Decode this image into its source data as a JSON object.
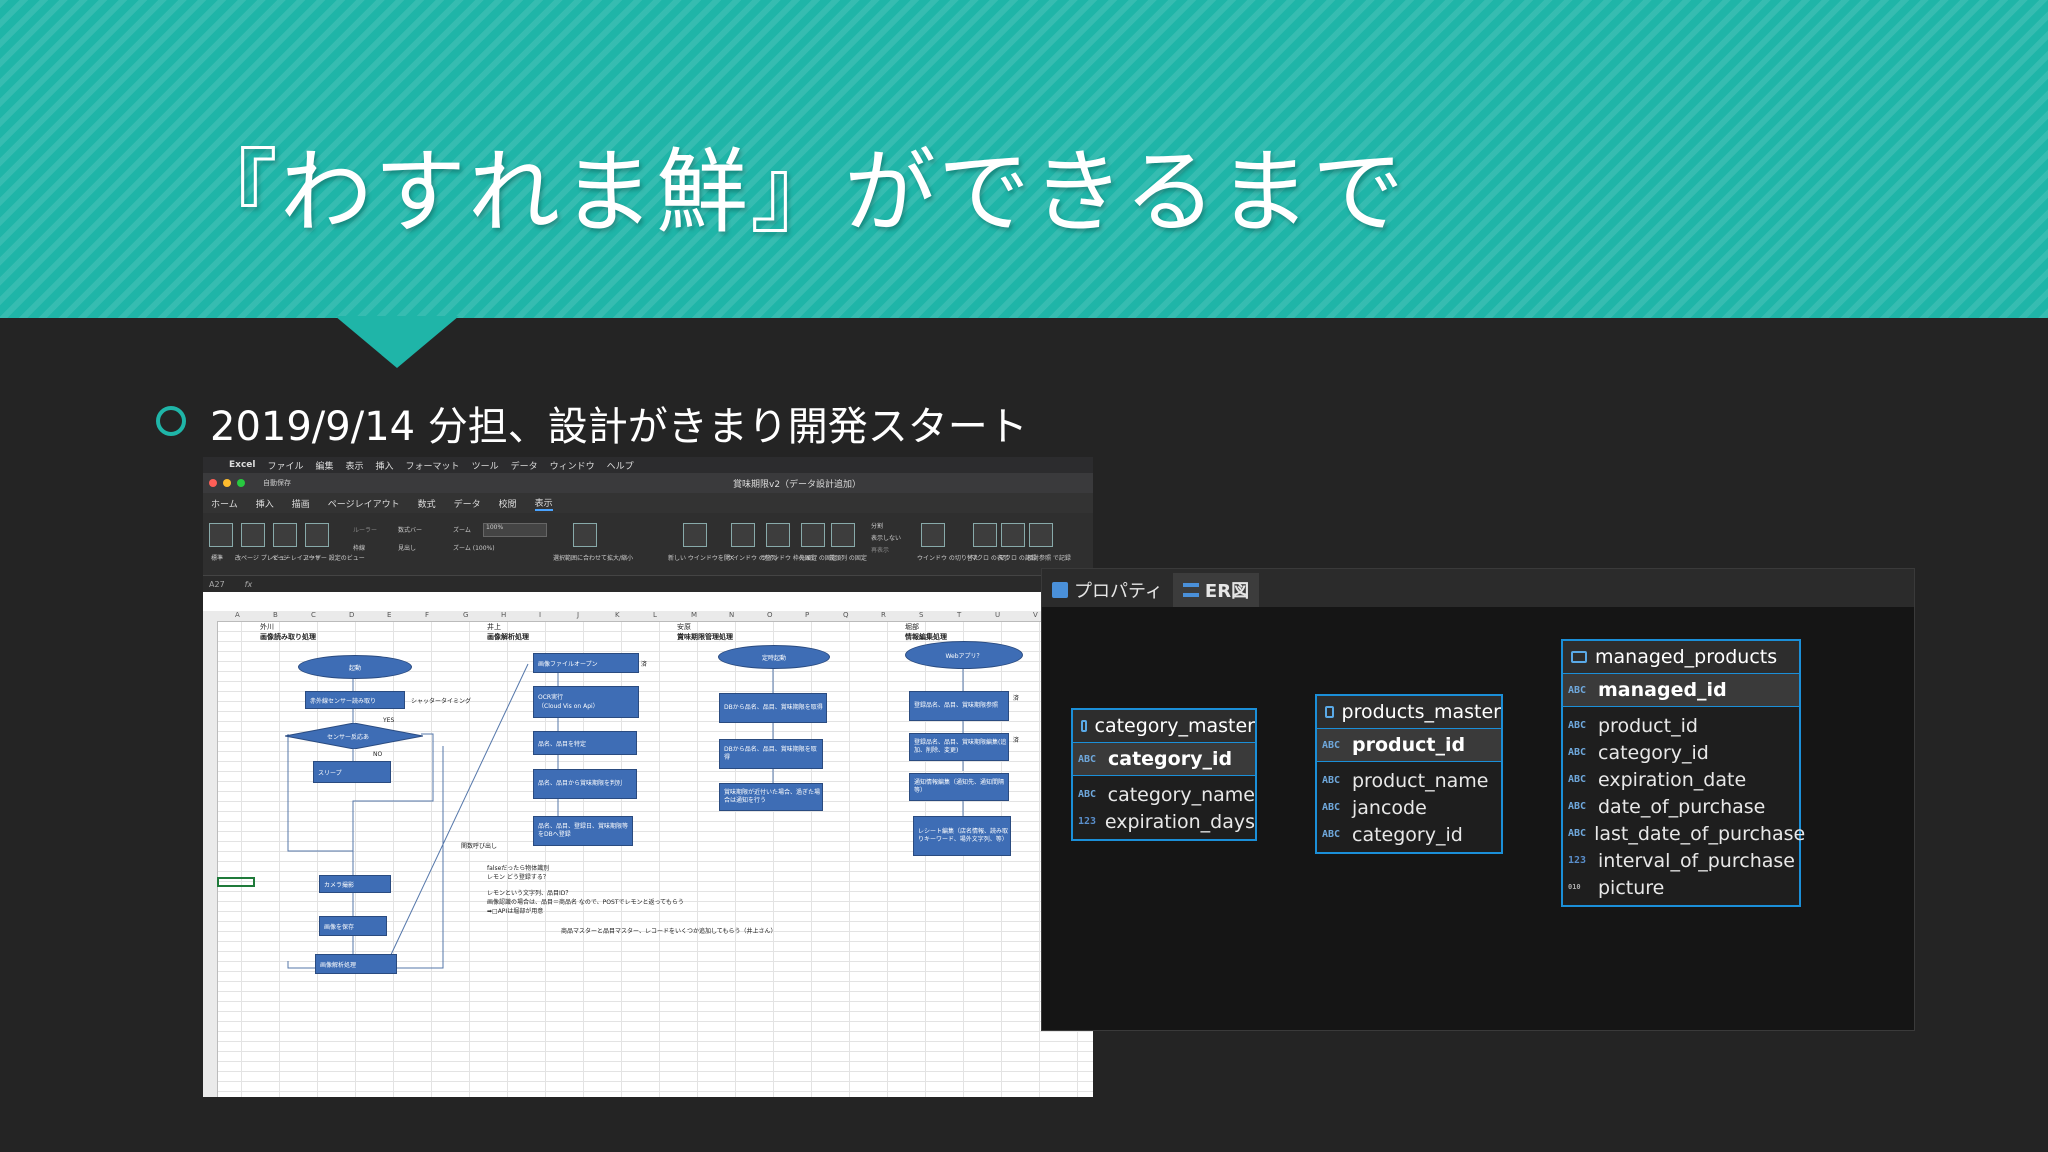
{
  "slide": {
    "title": "『わすれま鮮』ができるまで",
    "bullet": "2019/9/14 分担、設計がきまり開発スタート"
  },
  "excel": {
    "menu": [
      "Excel",
      "ファイル",
      "編集",
      "表示",
      "挿入",
      "フォーマット",
      "ツール",
      "データ",
      "ウィンドウ",
      "ヘルプ"
    ],
    "window_title": "賞味期限v2（データ設計追加）",
    "autosave": "自動保存",
    "ribbon_tabs": [
      "ホーム",
      "挿入",
      "描画",
      "ページレイアウト",
      "数式",
      "データ",
      "校閲",
      "表示"
    ],
    "ribbon_labels": {
      "normal": "標準",
      "page_break": "改ページ\nプレビュー",
      "page_layout": "ページ\nレイアウト",
      "custom_view": "ユーザー\n設定のビュー",
      "ruler": "ルーラー",
      "formula_bar": "数式バー",
      "gridlines": "枠線",
      "headings": "見出し",
      "zoom": "ズーム",
      "zoom_value": "100%",
      "zoom100": "ズーム (100%)",
      "zoom_selection": "選択範囲に合わせて拡大/縮小",
      "new_window": "新しい\nウインドウを開く",
      "arrange": "ウインドウ\nの整列",
      "freeze": "ウインドウ\n枠の固定",
      "freeze_top": "先頭行\nの固定",
      "freeze_first": "先頭列\nの固定",
      "split": "分割",
      "hide": "表示しない",
      "unhide": "再表示",
      "switch": "ウインドウ\nの切り替え",
      "macros": "マクロ\nの表示",
      "record": "マクロ\nの記録",
      "relative": "相対参照\nで記録"
    },
    "cell_ref": "A27",
    "fx": "fx",
    "columns": [
      "A",
      "B",
      "C",
      "D",
      "E",
      "F",
      "G",
      "H",
      "I",
      "J",
      "K",
      "L",
      "M",
      "N",
      "O",
      "P",
      "Q",
      "R",
      "S",
      "T",
      "U",
      "V"
    ],
    "lanes": [
      {
        "owner": "外川",
        "title": "画像読み取り処理"
      },
      {
        "owner": "井上",
        "title": "画像解析処理"
      },
      {
        "owner": "安原",
        "title": "賞味期限管理処理"
      },
      {
        "owner": "堀部",
        "title": "情報編集処理"
      }
    ],
    "flow1": {
      "start": "起動",
      "read": "赤外線センサー読み取り",
      "shutter": "シャッタータイミング",
      "yes": "YES",
      "decision": "センサー反応あ",
      "no": "NO",
      "sleep": "スリープ",
      "camera": "カメラ撮影",
      "save": "画像を保存",
      "analyze": "画像解析処理"
    },
    "flow2": {
      "open": "画像ファイルオープン",
      "done1": "済",
      "ocr": "OCR実行\n（Cloud Vis on Api）",
      "identify": "品名、品目を特定",
      "expiry": "品名、品目から賞味期限を判別",
      "register": "品名、品目、登録日、賞味期限等をDBへ登録",
      "func_call": "関数呼び出し"
    },
    "flow3": {
      "timer": "定時起動",
      "fetch1": "DBから品名、品目、賞味期限を取得",
      "fetch2": "DBから品名、品目、賞味期限を取得",
      "notify": "賞味期限が近付いた場合、過ぎた場合は通知を行う"
    },
    "flow4": {
      "webapp": "Webアプリ？",
      "ref": "登録品名、品目、賞味期限参照",
      "done2": "済",
      "edit": "登録品名、品目、賞味期限編集(追加、削除、変更)",
      "done3": "済",
      "notif_edit": "通知情報編集（通知先、通知間隔等）",
      "receipt": "レシート編集（店名情報、読み取りキーワード、場外文字列、等）"
    },
    "notes": [
      "falseだったら物体識別",
      "レモン どう登録する？",
      "レモンという文字列、品目ID？",
      "画像認識の場合は、品目＝商品名 なので、POSTでレモンと返ってもらう",
      "➡︎□APIは堀部が用意",
      "商品マスターと品目マスター、レコードをいくつか追加してもらう（井上さん）"
    ]
  },
  "er": {
    "tabs": [
      {
        "label": "プロパティ",
        "icon": "properties-icon"
      },
      {
        "label": "ER図",
        "icon": "er-diagram-icon"
      }
    ],
    "tables": [
      {
        "name": "category_master",
        "pk": "category_id",
        "pk_type": "ABC",
        "columns": [
          {
            "type": "ABC",
            "name": "category_name"
          },
          {
            "type": "123",
            "name": "expiration_days"
          }
        ]
      },
      {
        "name": "products_master",
        "pk": "product_id",
        "pk_type": "ABC",
        "columns": [
          {
            "type": "ABC",
            "name": "product_name"
          },
          {
            "type": "ABC",
            "name": "jancode"
          },
          {
            "type": "ABC",
            "name": "category_id"
          }
        ]
      },
      {
        "name": "managed_products",
        "pk": "managed_id",
        "pk_type": "ABC",
        "columns": [
          {
            "type": "ABC",
            "name": "product_id"
          },
          {
            "type": "ABC",
            "name": "category_id"
          },
          {
            "type": "ABC",
            "name": "expiration_date"
          },
          {
            "type": "ABC",
            "name": "date_of_purchase"
          },
          {
            "type": "ABC",
            "name": "last_date_of_purchase"
          },
          {
            "type": "123",
            "name": "interval_of_purchase"
          },
          {
            "type": "010",
            "name": "picture"
          }
        ]
      }
    ]
  },
  "colors": {
    "accent": "#1fb5a8",
    "background": "#242424",
    "er_border": "#1b8fd8",
    "flow_box": "#3e6db5"
  }
}
